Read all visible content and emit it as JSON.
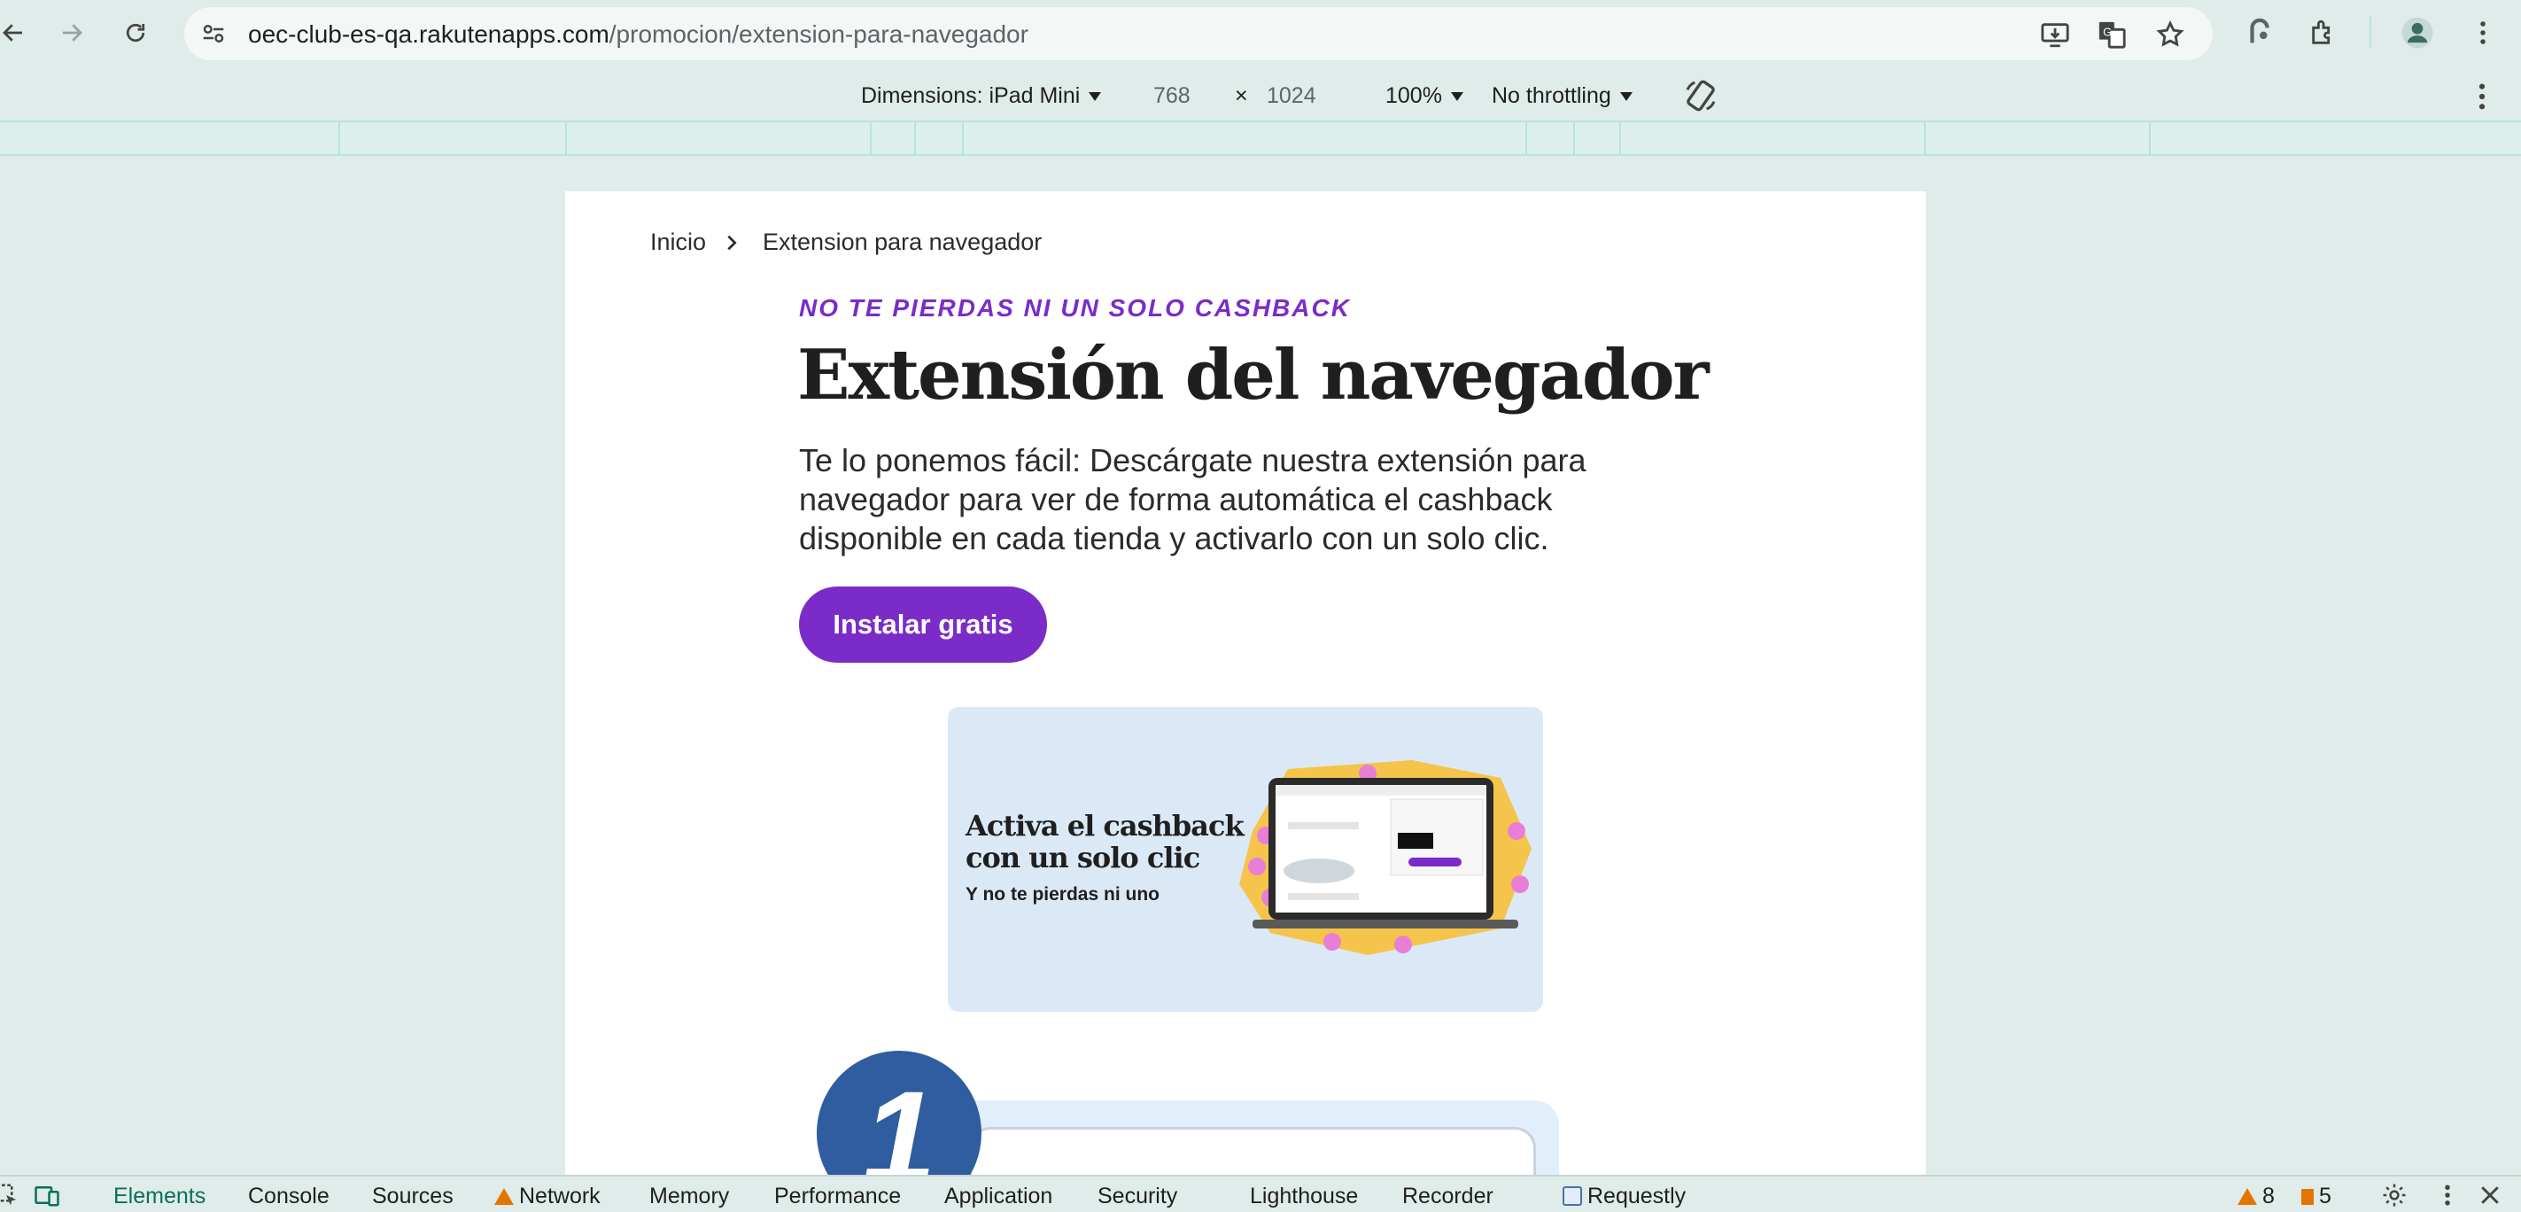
{
  "browser": {
    "url_host": "oec-club-es-qa.rakutenapps.com",
    "url_path": "/promocion/extension-para-navegador",
    "icons": [
      "back-icon",
      "forward-icon",
      "reload-icon",
      "site-info-icon",
      "install-app-icon",
      "translate-icon",
      "bookmark-star-icon",
      "requestly-icon",
      "extensions-icon",
      "profile-icon",
      "menu-icon"
    ]
  },
  "device_toolbar": {
    "dimensions_label": "Dimensions: iPad Mini",
    "width": "768",
    "times": "×",
    "height": "1024",
    "zoom": "100%",
    "throttling": "No throttling"
  },
  "page": {
    "breadcrumb": {
      "home": "Inicio",
      "current": "Extension para navegador"
    },
    "eyebrow": "NO TE PIERDAS NI UN SOLO CASHBACK",
    "headline": "Extensión del navegador",
    "intro": "Te lo ponemos fácil: Descárgate nuestra extensión para navegador para ver de forma automática el cashback disponible en cada tienda y activarlo con un solo clic.",
    "install_button": "Instalar gratis",
    "promo": {
      "title": "Activa el cashback con un solo clic",
      "subtitle": "Y no te pierdas ni uno"
    },
    "step_number": "1"
  },
  "devtools": {
    "tabs": [
      "Elements",
      "Console",
      "Sources",
      "Network",
      "Memory",
      "Performance",
      "Application",
      "Security",
      "Lighthouse",
      "Recorder",
      "Requestly"
    ],
    "active_tab": "Elements",
    "warnings_count": "8",
    "issues_count": "5"
  },
  "colors": {
    "accent_purple": "#7b2cc8",
    "step_blue": "#2f5da0",
    "promo_bg": "#dbe9f7",
    "chrome_bg": "#dfece9"
  }
}
